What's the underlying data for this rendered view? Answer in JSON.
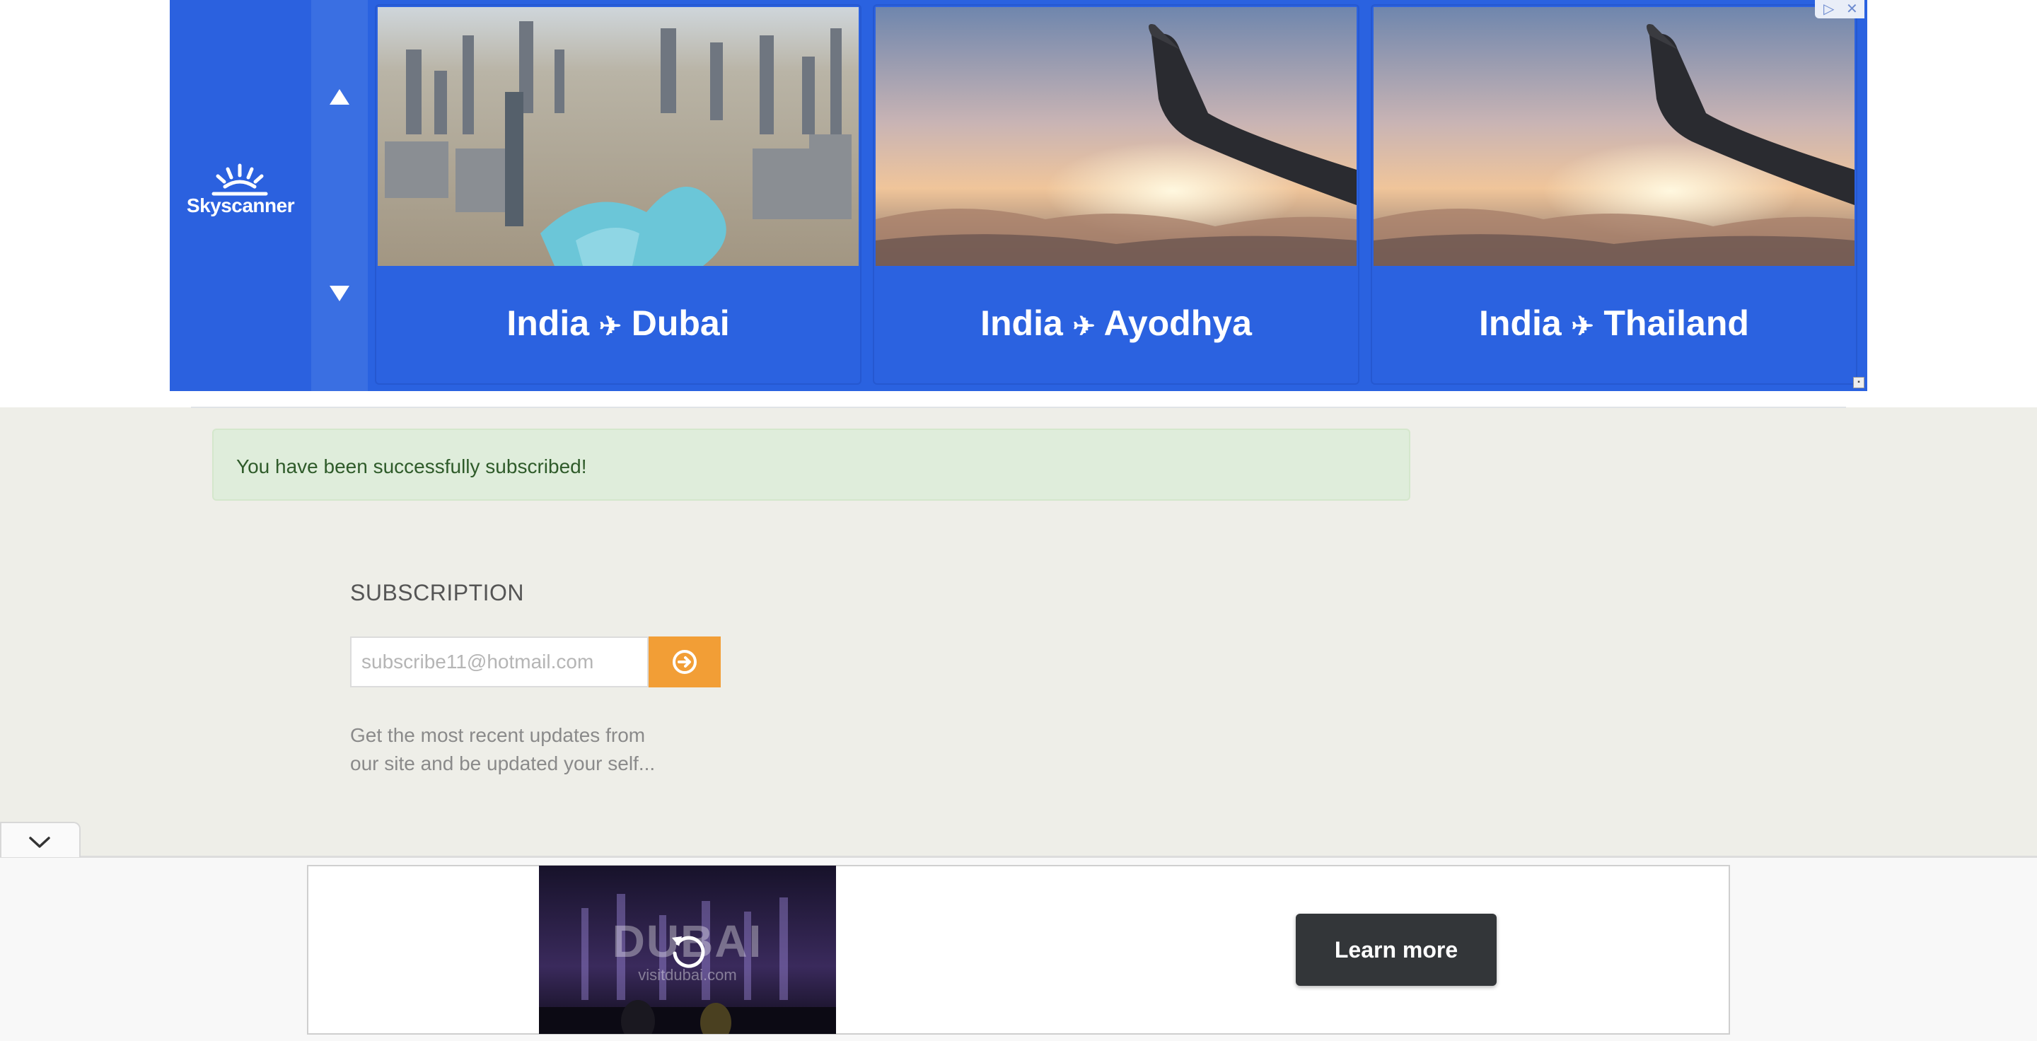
{
  "ad": {
    "brand_name": "Skyscanner",
    "destinations": [
      {
        "from": "India",
        "to": "Dubai",
        "image": "dubai-city-aerial"
      },
      {
        "from": "India",
        "to": "Ayodhya",
        "image": "airplane-wing-sunset"
      },
      {
        "from": "India",
        "to": "Thailand",
        "image": "airplane-wing-sunset"
      }
    ],
    "plane_glyph": "✈",
    "accent_color": "#2a62e0"
  },
  "alert": {
    "message": "You have been successfully subscribed!"
  },
  "subscription": {
    "title": "SUBSCRIPTION",
    "placeholder": "subscribe11@hotmail.com",
    "description_line1": "Get the most recent updates from",
    "description_line2": "our site and be updated your self...",
    "button_color": "#f29e36"
  },
  "bottom_ad": {
    "video_logo": "DUBAI",
    "video_site": "visitdubai.com",
    "cta_label": "Learn more"
  }
}
